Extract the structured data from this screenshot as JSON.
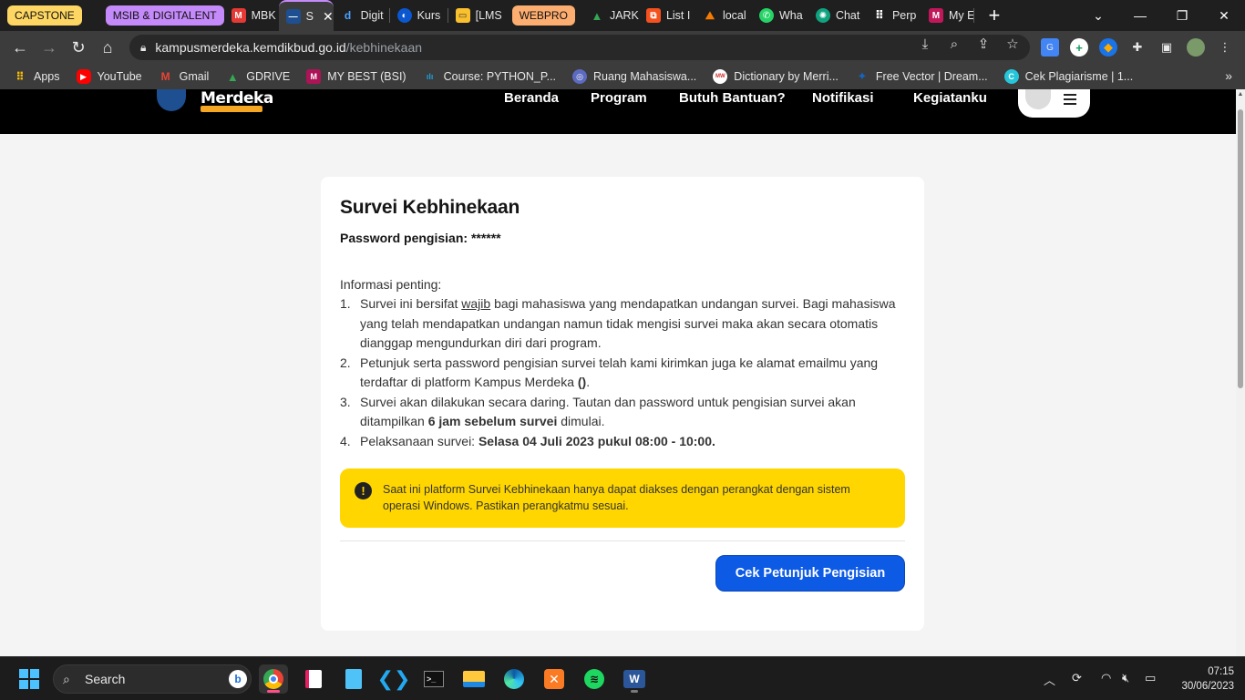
{
  "browser": {
    "tab_groups": [
      {
        "label": "CAPSTONE",
        "color": "#fdd663"
      },
      {
        "label": "MSIB & DIGITALENT",
        "color": "#c58af9"
      },
      {
        "label": "WEBPRO",
        "color": "#fcad70"
      }
    ],
    "tabs": [
      {
        "title": "MBK",
        "icon": "mbk-icon"
      },
      {
        "title": "S",
        "icon": "kampus-merdeka-icon",
        "active": true
      },
      {
        "title": "Digit",
        "icon": "digitalent-icon"
      },
      {
        "title": "Kurs",
        "icon": "kurs-icon"
      },
      {
        "title": "[LMS",
        "icon": "lms-icon"
      },
      {
        "title": "JARK",
        "icon": "google-drive-icon"
      },
      {
        "title": "List I",
        "icon": "list-icon"
      },
      {
        "title": "local",
        "icon": "local-icon"
      },
      {
        "title": "Wha",
        "icon": "whatsapp-icon"
      },
      {
        "title": "Chat",
        "icon": "chatgpt-icon"
      },
      {
        "title": "Perp",
        "icon": "grid-icon"
      },
      {
        "title": "My E",
        "icon": "my-e-icon"
      }
    ],
    "new_tab": "+",
    "address": {
      "host": "kampusmerdeka.kemdikbud.go.id",
      "path": "/kebhinekaan"
    },
    "bookmarks": [
      {
        "label": "Apps",
        "icon": "apps-grid-icon"
      },
      {
        "label": "YouTube",
        "icon": "youtube-icon"
      },
      {
        "label": "Gmail",
        "icon": "gmail-icon"
      },
      {
        "label": "GDRIVE",
        "icon": "google-drive-icon"
      },
      {
        "label": "MY BEST (BSI)",
        "icon": "bsi-icon"
      },
      {
        "label": "Course: PYTHON_P...",
        "icon": "cisco-icon"
      },
      {
        "label": "Ruang Mahasiswa...",
        "icon": "ruang-icon"
      },
      {
        "label": "Dictionary by Merri...",
        "icon": "merriam-webster-icon"
      },
      {
        "label": "Free Vector | Dream...",
        "icon": "dreamstime-icon"
      },
      {
        "label": "Cek Plagiarisme | 1...",
        "icon": "plagiarism-icon"
      }
    ],
    "bookmarks_overflow": "»"
  },
  "site": {
    "logo_text": "Merdeka",
    "nav": [
      "Beranda",
      "Program",
      "Butuh Bantuan?",
      "Notifikasi",
      "Kegiatanku"
    ]
  },
  "card": {
    "title": "Survei Kebhinekaan",
    "password_label": "Password pengisian:",
    "password_value": "******",
    "info_title": "Informasi penting:",
    "items": [
      {
        "num": "1.",
        "parts": [
          {
            "t": "Survei ini bersifat "
          },
          {
            "t": "wajib",
            "u": true
          },
          {
            "t": " bagi mahasiswa yang mendapatkan undangan survei. Bagi mahasiswa yang telah mendapatkan undangan namun tidak mengisi survei maka akan secara otomatis dianggap mengundurkan diri dari program."
          }
        ]
      },
      {
        "num": "2.",
        "parts": [
          {
            "t": "Petunjuk serta password pengisian survei telah kami kirimkan juga ke alamat emailmu yang terdaftar di platform Kampus Merdeka "
          },
          {
            "t": "()",
            "b": true
          },
          {
            "t": "."
          }
        ]
      },
      {
        "num": "3.",
        "parts": [
          {
            "t": "Survei akan dilakukan secara daring. Tautan dan password untuk pengisian survei akan ditampilkan "
          },
          {
            "t": "6 jam sebelum survei",
            "b": true
          },
          {
            "t": " dimulai."
          }
        ]
      },
      {
        "num": "4.",
        "parts": [
          {
            "t": "Pelaksanaan survei: "
          },
          {
            "t": "Selasa 04 Juli 2023 pukul 08:00 - 10:00.",
            "b": true
          }
        ]
      }
    ],
    "alert": "Saat ini platform Survei Kebhinekaan hanya dapat diakses dengan perangkat dengan sistem operasi Windows. Pastikan perangkatmu sesuai.",
    "cta": "Cek Petunjuk Pengisian"
  },
  "taskbar": {
    "search_placeholder": "Search",
    "time": "07:15",
    "date": "30/06/2023"
  }
}
